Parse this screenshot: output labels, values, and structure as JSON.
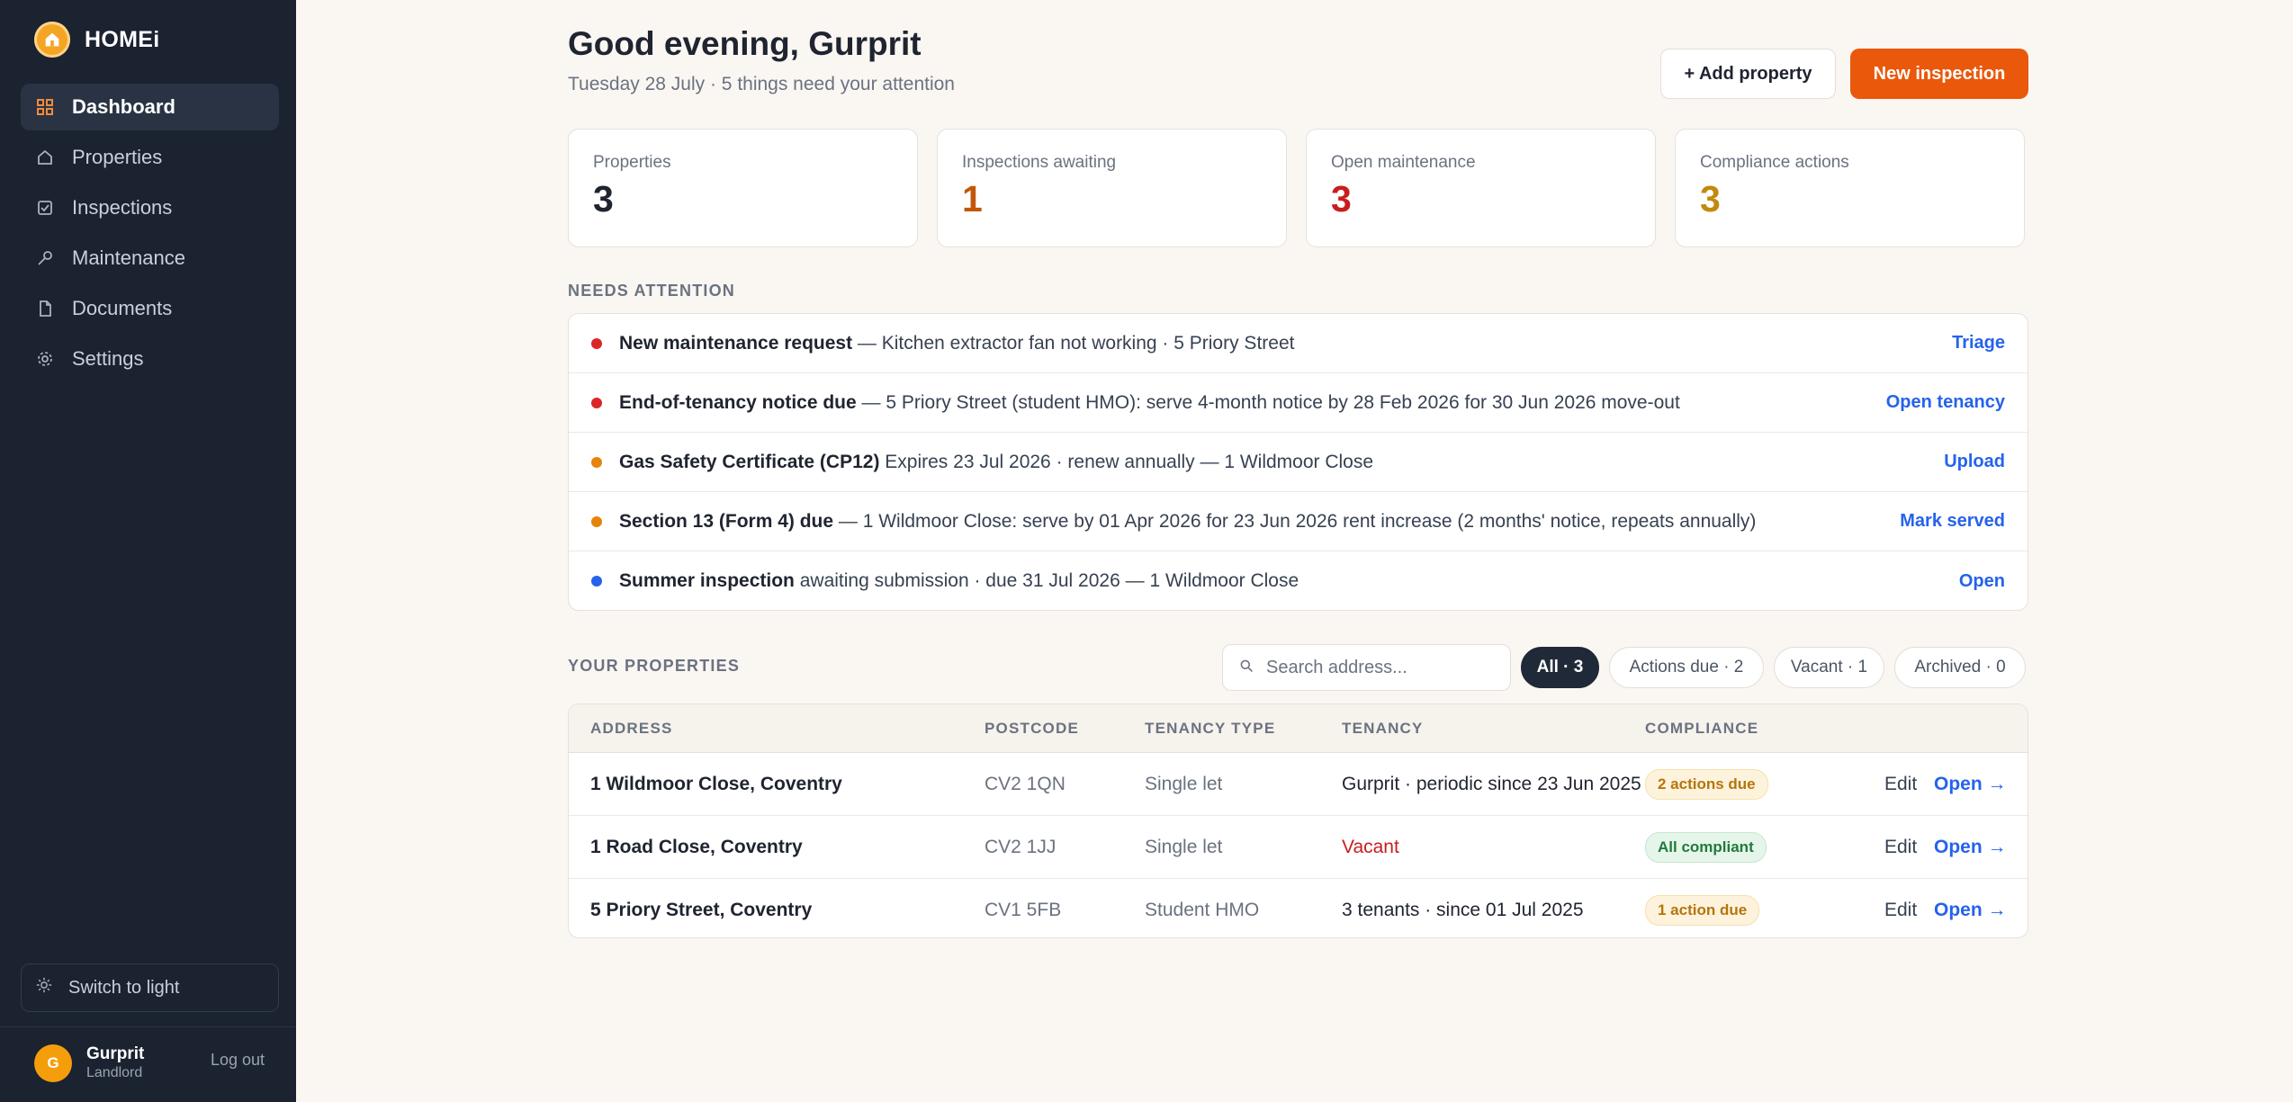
{
  "app": {
    "name": "HOMEi"
  },
  "sidebar": {
    "items": [
      {
        "label": "Dashboard",
        "icon": "grid-icon",
        "active": true
      },
      {
        "label": "Properties",
        "icon": "home-icon",
        "active": false
      },
      {
        "label": "Inspections",
        "icon": "checkbox-icon",
        "active": false
      },
      {
        "label": "Maintenance",
        "icon": "wrench-icon",
        "active": false
      },
      {
        "label": "Documents",
        "icon": "document-icon",
        "active": false
      },
      {
        "label": "Settings",
        "icon": "gear-icon",
        "active": false
      }
    ],
    "theme_toggle": "Switch to light",
    "user": {
      "initial": "G",
      "name": "Gurprit",
      "role": "Landlord"
    },
    "logout": "Log out"
  },
  "header": {
    "greeting": "Good evening, Gurprit",
    "subline": "Tuesday 28 July · 5 things need your attention",
    "add_property": "+ Add property",
    "new_inspection": "New inspection"
  },
  "stats": [
    {
      "label": "Properties",
      "value": "3",
      "color": "#1f2430"
    },
    {
      "label": "Inspections awaiting",
      "value": "1",
      "color": "#c2570c"
    },
    {
      "label": "Open maintenance",
      "value": "3",
      "color": "#c81e1e"
    },
    {
      "label": "Compliance actions",
      "value": "3",
      "color": "#c28a0c"
    }
  ],
  "attention": {
    "title": "NEEDS ATTENTION",
    "items": [
      {
        "title": "New maintenance request",
        "detail": " — Kitchen extractor fan not working · 5 Priory Street",
        "action": "Triage",
        "color": "#dc2626"
      },
      {
        "title": "End-of-tenancy notice due",
        "detail": " — 5 Priory Street (student HMO): serve 4-month notice by 28 Feb 2026 for 30 Jun 2026 move-out",
        "action": "Open tenancy",
        "color": "#dc2626"
      },
      {
        "title": "Gas Safety Certificate (CP12)",
        "detail": " Expires 23 Jul 2026 · renew annually — 1 Wildmoor Close",
        "action": "Upload",
        "color": "#e6830b"
      },
      {
        "title": "Section 13 (Form 4) due",
        "detail": " — 1 Wildmoor Close: serve by 01 Apr 2026 for 23 Jun 2026 rent increase (2 months' notice, repeats annually)",
        "action": "Mark served",
        "color": "#e6830b"
      },
      {
        "title": "Summer inspection",
        "detail": " awaiting submission · due 31 Jul 2026 — 1 Wildmoor Close",
        "action": "Open",
        "color": "#2563eb"
      }
    ]
  },
  "properties": {
    "title": "YOUR PROPERTIES",
    "search_placeholder": "Search address...",
    "filters": [
      "All · 3",
      "Actions due · 2",
      "Vacant · 1",
      "Archived · 0"
    ],
    "columns": [
      "ADDRESS",
      "POSTCODE",
      "TENANCY TYPE",
      "TENANCY",
      "COMPLIANCE"
    ],
    "rows": [
      {
        "address": "1 Wildmoor Close, Coventry",
        "postcode": "CV2 1QN",
        "type": "Single let",
        "tenancy": "Gurprit · periodic since 23 Jun 2025",
        "vacant": false,
        "compliance": "2 actions due",
        "status": "warn",
        "edit": "Edit",
        "open": "Open →"
      },
      {
        "address": "1 Road Close, Coventry",
        "postcode": "CV2 1JJ",
        "type": "Single let",
        "tenancy": "Vacant",
        "vacant": true,
        "compliance": "All compliant",
        "status": "ok",
        "edit": "Edit",
        "open": "Open →"
      },
      {
        "address": "5 Priory Street, Coventry",
        "postcode": "CV1 5FB",
        "type": "Student HMO",
        "tenancy": "3 tenants · since 01 Jul 2025",
        "vacant": false,
        "compliance": "1 action due",
        "status": "warn",
        "edit": "Edit",
        "open": "Open →"
      }
    ]
  }
}
